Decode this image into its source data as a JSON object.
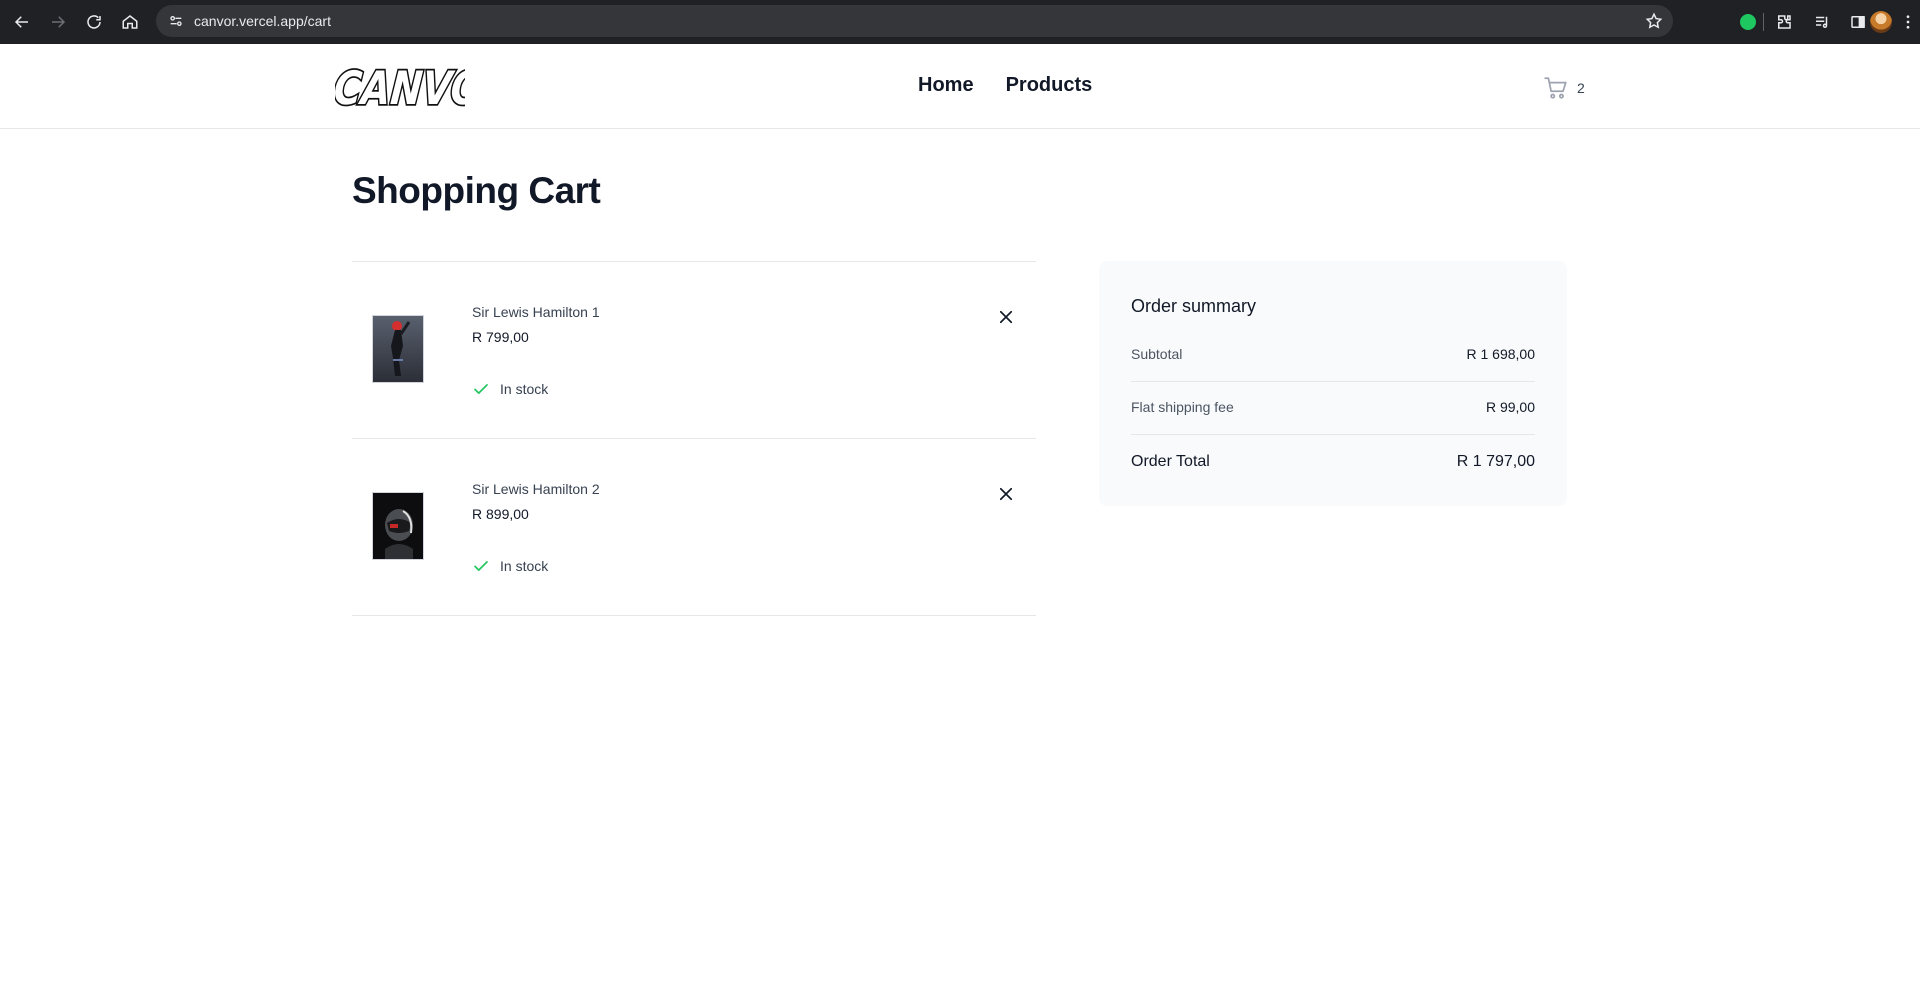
{
  "browser": {
    "url": "canvor.vercel.app/cart"
  },
  "header": {
    "logo_text": "CANVOR",
    "nav": [
      "Home",
      "Products"
    ],
    "cart_count": "2"
  },
  "page": {
    "title": "Shopping Cart"
  },
  "cart": {
    "items": [
      {
        "name": "Sir Lewis Hamilton 1",
        "price": "R 799,00",
        "stock": "In stock"
      },
      {
        "name": "Sir Lewis Hamilton 2",
        "price": "R 899,00",
        "stock": "In stock"
      }
    ]
  },
  "summary": {
    "title": "Order summary",
    "subtotal_label": "Subtotal",
    "subtotal_value": "R 1 698,00",
    "shipping_label": "Flat shipping fee",
    "shipping_value": "R 99,00",
    "total_label": "Order Total",
    "total_value": "R 1 797,00"
  },
  "colors": {
    "in_stock_check": "#22c55e",
    "browser_bar": "#202124",
    "summary_bg": "#f9fafb"
  }
}
